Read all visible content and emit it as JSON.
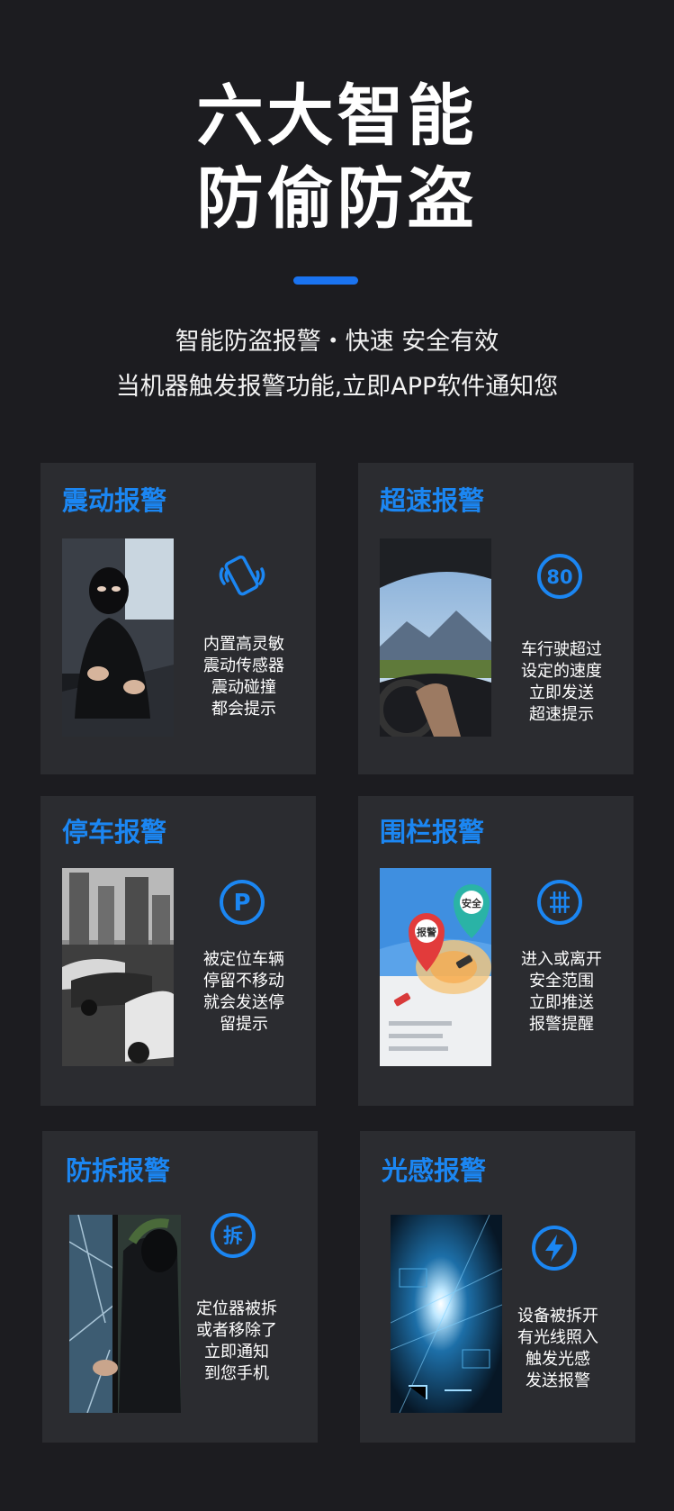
{
  "header": {
    "title_line1": "六大智能",
    "title_line2": "防偷防盗",
    "subtitle_line1": "智能防盗报警・快速 安全有效",
    "subtitle_line2": "当机器触发报警功能,立即APP软件通知您"
  },
  "cards": [
    {
      "title": "震动报警",
      "icon": "vibrating-phone-icon",
      "lines": [
        "内置高灵敏",
        "震动传感器",
        "震动碰撞",
        "都会提示"
      ]
    },
    {
      "title": "超速报警",
      "icon": "speed-limit-80-icon",
      "icon_text": "80",
      "lines": [
        "车行驶超过",
        "设定的速度",
        "立即发送",
        "超速提示"
      ]
    },
    {
      "title": "停车报警",
      "icon": "parking-p-icon",
      "icon_text": "P",
      "lines": [
        "被定位车辆",
        "停留不移动",
        "就会发送停",
        "留提示"
      ]
    },
    {
      "title": "围栏报警",
      "icon": "fence-grid-icon",
      "lines": [
        "进入或离开",
        "安全范围",
        "立即推送",
        "报警提醒"
      ],
      "map_pins": [
        "报警",
        "安全"
      ]
    },
    {
      "title": "防拆报警",
      "icon": "dismantle-icon",
      "icon_text": "拆",
      "lines": [
        "定位器被拆",
        "或者移除了",
        "立即通知",
        "到您手机"
      ]
    },
    {
      "title": "光感报警",
      "icon": "lightning-icon",
      "lines": [
        "设备被拆开",
        "有光线照入",
        "触发光感",
        "发送报警"
      ]
    }
  ],
  "colors": {
    "accent": "#1a73f0",
    "title_blue": "#1b86f2",
    "card_bg": "#2b2c30",
    "page_bg": "#1c1c20"
  }
}
